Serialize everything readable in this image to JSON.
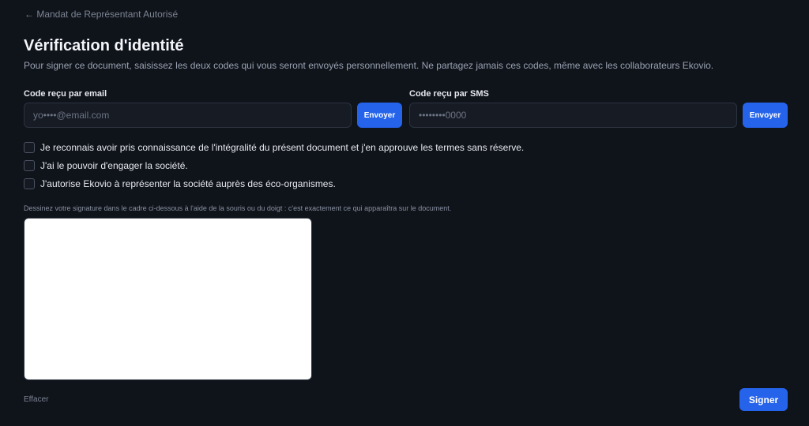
{
  "header": {
    "back_link": "← Mandat de Représentant Autorisé",
    "title": "Vérification d'identité",
    "subtitle": "Pour signer ce document, saisissez les deux codes qui vous seront envoyés personnellement. Ne partagez jamais ces codes, même avec les collaborateurs Ekovio."
  },
  "email_code": {
    "label": "Code reçu par email",
    "placeholder": "yo••••@email.com",
    "value": "",
    "send_label": "Envoyer"
  },
  "sms_code": {
    "label": "Code reçu par SMS",
    "placeholder": "••••••••0000",
    "value": "",
    "send_label": "Envoyer"
  },
  "checkboxes": [
    {
      "label": "Je reconnais avoir pris connaissance de l'intégralité du présent document et j'en approuve les termes sans réserve.",
      "checked": false
    },
    {
      "label": "J'ai le pouvoir d'engager la société.",
      "checked": false
    },
    {
      "label": "J'autorise Ekovio à représenter la société auprès des éco-organismes.",
      "checked": false
    }
  ],
  "signature": {
    "help_text": "Dessinez votre signature dans le cadre ci-dessous à l'aide de la souris ou du doigt : c'est exactement ce qui apparaîtra sur le document.",
    "clear_label": "Effacer"
  },
  "actions": {
    "sign_label": "Signer"
  },
  "colors": {
    "background": "#0f131a",
    "accent": "#2563eb",
    "input_background": "#161b24",
    "signature_pad": "#ffffff"
  }
}
